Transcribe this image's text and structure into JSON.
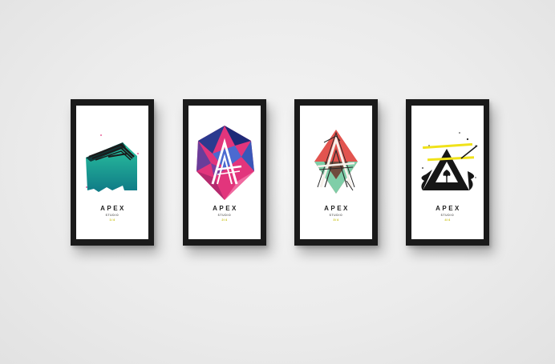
{
  "scene": "four framed poster mockups on a wall",
  "posters": [
    {
      "brand": "APEX",
      "sub": "STUDIO",
      "number": "1/4",
      "art": "teal-gradient-folded-letter-a-icon"
    },
    {
      "brand": "APEX",
      "sub": "STUDIO",
      "number": "2/4",
      "art": "faceted-crystal-letter-a-icon"
    },
    {
      "brand": "APEX",
      "sub": "STUDIO",
      "number": "3/4",
      "art": "red-green-diamond-letter-a-icon"
    },
    {
      "brand": "APEX",
      "sub": "STUDIO",
      "number": "4/4",
      "art": "ink-splatter-triangle-tree-icon"
    }
  ],
  "colors": {
    "frame": "#1a1a1a",
    "accent_yellow": "#c9c21a",
    "teal": "#1fb597",
    "magenta": "#e2357c",
    "navy": "#1e2a78",
    "coral": "#e2544f",
    "mint": "#7fcea8"
  }
}
